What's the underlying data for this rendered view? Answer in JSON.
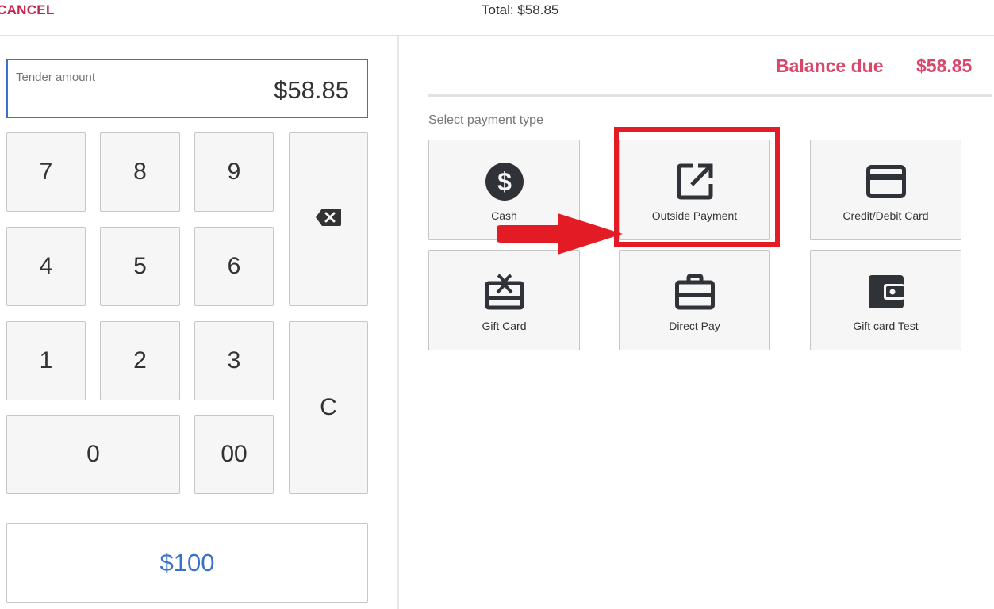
{
  "header": {
    "cancel_label": "CANCEL",
    "total_text": "Total: $58.85"
  },
  "tender": {
    "label": "Tender amount",
    "value": "$58.85"
  },
  "keypad": {
    "k7": "7",
    "k8": "8",
    "k9": "9",
    "k4": "4",
    "k5": "5",
    "k6": "6",
    "k1": "1",
    "k2": "2",
    "k3": "3",
    "k0": "0",
    "k00": "00",
    "clear": "C",
    "backspace_icon": "backspace-icon",
    "quick_amount": "$100"
  },
  "balance": {
    "label": "Balance due",
    "value": "$58.85"
  },
  "payment": {
    "section_label": "Select payment type",
    "types": [
      {
        "label": "Cash",
        "icon": "dollar-circle-icon"
      },
      {
        "label": "Outside Payment",
        "icon": "external-link-icon"
      },
      {
        "label": "Credit/Debit Card",
        "icon": "credit-card-icon"
      },
      {
        "label": "Gift Card",
        "icon": "gift-card-icon"
      },
      {
        "label": "Direct Pay",
        "icon": "briefcase-icon"
      },
      {
        "label": "Gift card Test",
        "icon": "wallet-icon"
      }
    ]
  },
  "colors": {
    "accent_blue": "#3a72c9",
    "balance_red": "#d9476a",
    "cancel_red": "#c2234b",
    "annotation_red": "#e21b24"
  }
}
